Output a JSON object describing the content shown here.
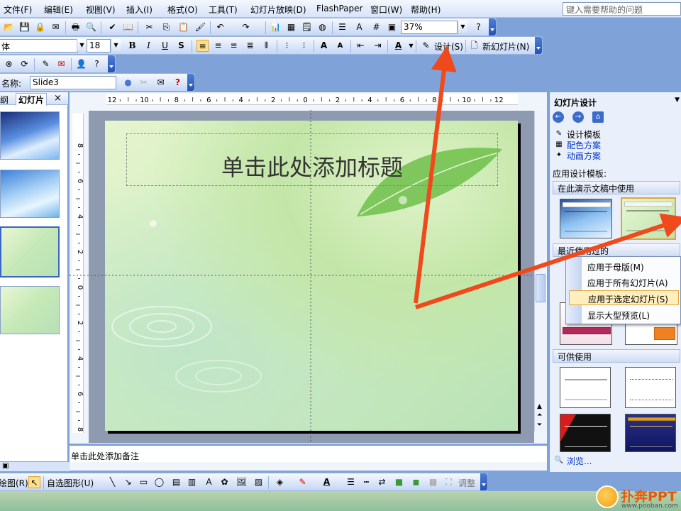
{
  "menu": {
    "items": [
      "文件(F)",
      "编辑(E)",
      "视图(V)",
      "插入(I)",
      "格式(O)",
      "工具(T)",
      "幻灯片放映(D)",
      "FlashPaper",
      "窗口(W)",
      "帮助(H)"
    ],
    "help_placeholder": "键入需要帮助的问题"
  },
  "standard_toolbar": {
    "zoom": "37%"
  },
  "format_toolbar": {
    "font_size": "18",
    "design_label": "设计(S)",
    "new_slide_label": "新幻灯片(N)"
  },
  "name_toolbar": {
    "label": "名称:",
    "slide_name": "Slide3"
  },
  "left_pane": {
    "tabs": [
      "纲",
      "幻灯片"
    ],
    "close_glyph": "×"
  },
  "slide": {
    "title_placeholder": "单击此处添加标题",
    "notes_placeholder": "单击此处添加备注"
  },
  "ruler": {
    "h_labels": [
      "12",
      "10",
      "8",
      "6",
      "4",
      "2",
      "0",
      "2",
      "4",
      "6",
      "8",
      "10",
      "12"
    ],
    "v_labels": [
      "8",
      "6",
      "4",
      "2",
      "0",
      "2",
      "4",
      "6",
      "8"
    ]
  },
  "task_pane": {
    "title": "幻灯片设计",
    "links": [
      "设计模板",
      "配色方案",
      "动画方案"
    ],
    "apply_label": "应用设计模板:",
    "section_used": "在此演示文稿中使用",
    "section_recent": "最近使用过的",
    "section_available": "可供使用",
    "browse": "浏览..."
  },
  "context_menu": {
    "items": [
      "应用于母版(M)",
      "应用于所有幻灯片(A)",
      "应用于选定幻灯片(S)",
      "显示大型预览(L)"
    ],
    "highlighted_index": 2
  },
  "drawing_toolbar": {
    "draw_label": "绘图(R)",
    "autoshapes_label": "自选图形(U)",
    "adjust_label": "调整"
  },
  "brand": {
    "name": "扑奔PPT",
    "url": "www.pooban.com"
  },
  "colors": {
    "annotation_arrow": "#f04a1c",
    "accent_blue": "#2453b3"
  }
}
